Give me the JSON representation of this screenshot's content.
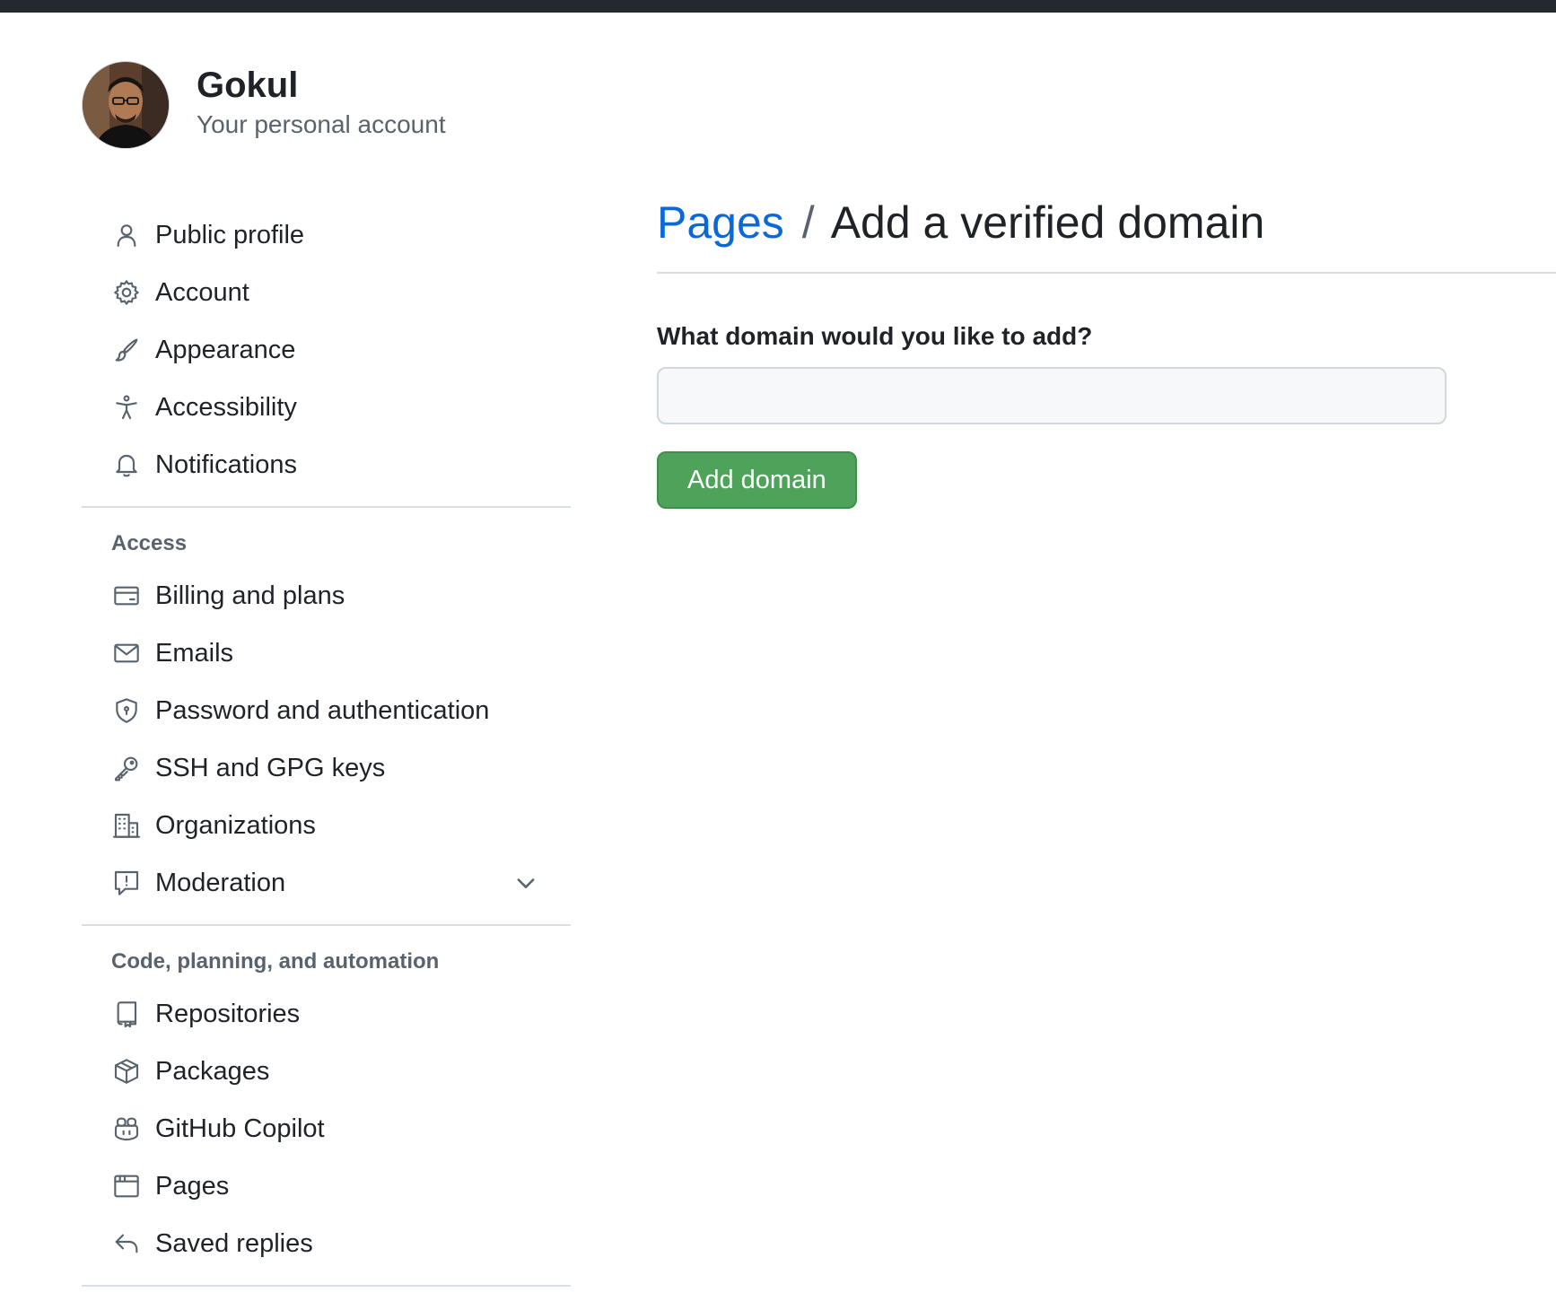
{
  "user": {
    "name": "Gokul",
    "subtitle": "Your personal account"
  },
  "sidebar": {
    "primary": [
      {
        "label": "Public profile",
        "icon": "person-icon"
      },
      {
        "label": "Account",
        "icon": "gear-icon"
      },
      {
        "label": "Appearance",
        "icon": "paintbrush-icon"
      },
      {
        "label": "Accessibility",
        "icon": "accessibility-icon"
      },
      {
        "label": "Notifications",
        "icon": "bell-icon"
      }
    ],
    "access": {
      "heading": "Access",
      "items": [
        {
          "label": "Billing and plans",
          "icon": "credit-card-icon"
        },
        {
          "label": "Emails",
          "icon": "mail-icon"
        },
        {
          "label": "Password and authentication",
          "icon": "shield-icon"
        },
        {
          "label": "SSH and GPG keys",
          "icon": "key-icon"
        },
        {
          "label": "Organizations",
          "icon": "organization-icon"
        },
        {
          "label": "Moderation",
          "icon": "report-icon"
        }
      ]
    },
    "code": {
      "heading": "Code, planning, and automation",
      "items": [
        {
          "label": "Repositories",
          "icon": "repo-icon"
        },
        {
          "label": "Packages",
          "icon": "package-icon"
        },
        {
          "label": "GitHub Copilot",
          "icon": "copilot-icon"
        },
        {
          "label": "Pages",
          "icon": "browser-icon"
        },
        {
          "label": "Saved replies",
          "icon": "reply-icon"
        }
      ]
    }
  },
  "main": {
    "breadcrumb_parent": "Pages",
    "breadcrumb_separator": "/",
    "breadcrumb_current": "Add a verified domain",
    "field_label": "What domain would you like to add?",
    "domain_input_value": "",
    "domain_input_placeholder": "",
    "add_button_label": "Add domain"
  },
  "colors": {
    "link": "#0969da",
    "button_green": "#4ea25a",
    "topbar": "#24292f",
    "muted_text": "#59636e"
  }
}
